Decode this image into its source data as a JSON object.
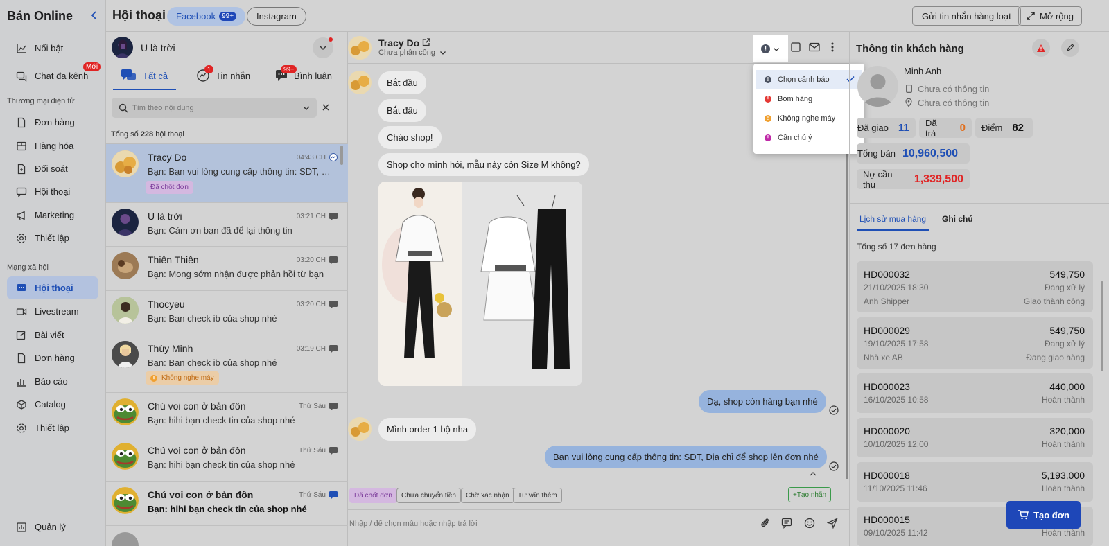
{
  "sidebar": {
    "brand": "Bán Online",
    "items_top": [
      {
        "label": "Nổi bật",
        "icon": "chart-line-icon"
      },
      {
        "label": "Chat đa kênh",
        "icon": "chat-multi-icon",
        "badge": "Mới"
      }
    ],
    "section_commerce": "Thương mại điện tử",
    "items_commerce": [
      {
        "label": "Đơn hàng",
        "icon": "document-icon"
      },
      {
        "label": "Hàng hóa",
        "icon": "box-icon"
      },
      {
        "label": "Đối soát",
        "icon": "reconcile-icon"
      },
      {
        "label": "Hội thoại",
        "icon": "chat-icon"
      },
      {
        "label": "Marketing",
        "icon": "megaphone-icon"
      },
      {
        "label": "Thiết lập",
        "icon": "gear-icon"
      }
    ],
    "section_social": "Mạng xã hội",
    "items_social": [
      {
        "label": "Hội thoại",
        "icon": "chat-icon",
        "active": true
      },
      {
        "label": "Livestream",
        "icon": "video-icon"
      },
      {
        "label": "Bài viết",
        "icon": "edit-icon"
      },
      {
        "label": "Đơn hàng",
        "icon": "document-icon"
      },
      {
        "label": "Báo cáo",
        "icon": "bar-chart-icon"
      },
      {
        "label": "Catalog",
        "icon": "catalog-icon"
      },
      {
        "label": "Thiết lập",
        "icon": "gear-icon"
      }
    ],
    "bottom": {
      "label": "Quản lý",
      "icon": "dashboard-icon"
    }
  },
  "header": {
    "title": "Hội thoại",
    "tab_facebook": "Facebook",
    "tab_facebook_count": "99+",
    "tab_instagram": "Instagram",
    "bulk_button": "Gửi tin nhắn hàng loạt",
    "expand_button": "Mở rộng"
  },
  "list": {
    "page_name": "U là trời",
    "tabs": [
      {
        "label": "Tất cả",
        "active": true
      },
      {
        "label": "Tin nhắn",
        "badge": "1"
      },
      {
        "label": "Bình luận",
        "badge": "99+"
      }
    ],
    "search_placeholder": "Tìm theo nội dung",
    "total_prefix": "Tổng số",
    "total_count": "228",
    "total_suffix": "hội thoại",
    "conversations": [
      {
        "name": "Tracy Do",
        "time": "04:43 CH",
        "msg": "Bạn: Bạn vui lòng cung cấp thông tin: SDT, Địa c...",
        "tag": "Đã chốt đơn",
        "selected": true
      },
      {
        "name": "U là trời",
        "time": "03:21 CH",
        "msg": "Bạn: Cảm ơn bạn đã để lại thông tin"
      },
      {
        "name": "Thiên Thiên",
        "time": "03:20 CH",
        "msg": "Bạn: Mong sớm nhận được phản hồi từ bạn"
      },
      {
        "name": "Thocyeu",
        "time": "03:20 CH",
        "msg": "Bạn: Bạn check ib của shop nhé"
      },
      {
        "name": "Thùy Minh",
        "time": "03:19 CH",
        "msg": "Bạn: Bạn check ib của shop nhé",
        "tag": "Không nghe máy"
      },
      {
        "name": "Chú voi con ở bản đôn",
        "time": "Thứ Sáu",
        "msg": "Bạn: hihi bạn check tin của shop nhé"
      },
      {
        "name": "Chú voi con ở bản đôn",
        "time": "Thứ Sáu",
        "msg": "Bạn: hihi bạn check tin của shop nhé"
      },
      {
        "name": "Chú voi con ở bản đôn",
        "time": "Thứ Sáu",
        "msg": "Bạn: hihi bạn check tin của shop nhé",
        "unread": true
      }
    ]
  },
  "chat": {
    "contact_name": "Tracy Do",
    "assign_status": "Chưa phân công",
    "messages": [
      {
        "text": "Bắt đầu",
        "from": "them"
      },
      {
        "text": "Bắt đầu",
        "from": "them"
      },
      {
        "text": "Chào shop!",
        "from": "them"
      },
      {
        "text": "Shop cho mình hỏi, mẫu này còn Size M không?",
        "from": "them"
      },
      {
        "text": "Dạ, shop còn hàng bạn nhé",
        "from": "me"
      },
      {
        "text": "Mình order 1 bộ nha",
        "from": "them"
      },
      {
        "text": "Bạn vui lòng cung cấp thông tin: SDT, Địa chỉ để shop lên đơn nhé",
        "from": "me"
      }
    ],
    "quick_tags": [
      "Đã chốt đơn",
      "Chưa chuyển tiền",
      "Chờ xác nhận",
      "Tư vấn thêm"
    ],
    "create_tag": "+Tạo nhãn",
    "input_placeholder": "Nhập / để chọn mẫu hoặc nhập trả lời"
  },
  "warning_menu": {
    "items": [
      {
        "label": "Chọn cảnh báo",
        "color": "#4a5160",
        "selected": true
      },
      {
        "label": "Bom hàng",
        "color": "#e53935"
      },
      {
        "label": "Không nghe máy",
        "color": "#f0a030"
      },
      {
        "label": "Cần chú ý",
        "color": "#c02aa8"
      }
    ]
  },
  "customer": {
    "panel_title": "Thông tin khách hàng",
    "name": "Minh Anh",
    "phone": "Chưa có thông tin",
    "address": "Chưa có thông tin",
    "delivered_label": "Đã giao",
    "delivered": "11",
    "returned_label": "Đã trả",
    "returned": "0",
    "points_label": "Điểm",
    "points": "82",
    "total_sales_label": "Tổng bán",
    "total_sales": "10,960,500",
    "debt_label": "Nợ cần thu",
    "debt": "1,339,500",
    "tab_history": "Lịch sử mua hàng",
    "tab_notes": "Ghi chú",
    "orders_total": "Tổng số 17 đơn hàng",
    "orders": [
      {
        "id": "HD000032",
        "amount": "549,750",
        "date": "21/10/2025 18:30",
        "status": "Đang xử lý",
        "shipper": "Anh Shipper",
        "delivery": "Giao thành công"
      },
      {
        "id": "HD000029",
        "amount": "549,750",
        "date": "19/10/2025 17:58",
        "status": "Đang xử lý",
        "shipper": "Nhà xe AB",
        "delivery": "Đang giao hàng"
      },
      {
        "id": "HD000023",
        "amount": "440,000",
        "date": "16/10/2025 10:58",
        "status": "Hoàn thành"
      },
      {
        "id": "HD000020",
        "amount": "320,000",
        "date": "10/10/2025 12:00",
        "status": "Hoàn thành"
      },
      {
        "id": "HD000018",
        "amount": "5,193,000",
        "date": "11/10/2025 11:46",
        "status": "Hoàn thành"
      },
      {
        "id": "HD000015",
        "amount": "",
        "date": "09/10/2025 11:42",
        "status": "Hoàn thành"
      }
    ],
    "create_order": "Tạo đơn"
  },
  "colors": {
    "accent": "#1f4fb5",
    "sidebar_bg": "#cfd0d2",
    "danger": "#e02424",
    "brand_blue": "#1e47b8"
  }
}
